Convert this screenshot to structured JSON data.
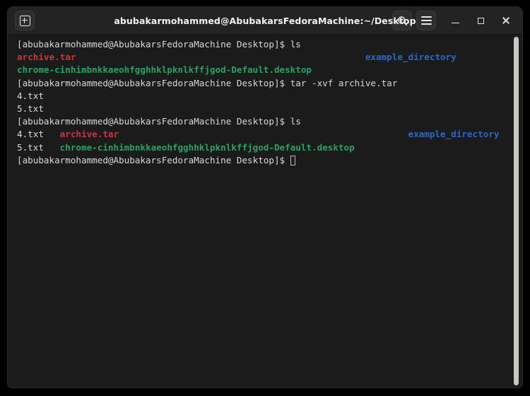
{
  "window": {
    "title": "abubakarmohammed@AbubakarsFedoraMachine:~/Desktop",
    "new_tab_label": "+",
    "icons": {
      "new_tab": "new-tab-icon",
      "search": "search-icon",
      "menu": "hamburger-menu-icon",
      "minimize": "minimize-icon",
      "maximize": "maximize-icon",
      "close": "close-icon"
    }
  },
  "colors": {
    "background": "#1b1b1b",
    "titlebar": "#232323",
    "foreground": "#d8d8d8",
    "red": "#c9353f",
    "green": "#26a269",
    "blue": "#2a67c8",
    "scrollbar": "#c9c7c2"
  },
  "terminal": {
    "prompt": "[abubakarmohammed@AbubakarsFedoraMachine Desktop]$ ",
    "lines": [
      {
        "type": "prompt",
        "command": "ls"
      },
      {
        "type": "output",
        "cells": [
          {
            "text": "archive.tar",
            "color": "red",
            "pad_to": 65
          },
          {
            "text": "example_directory",
            "color": "blue"
          }
        ]
      },
      {
        "type": "output",
        "cells": [
          {
            "text": "chrome-cinhimbnkkaeohfgghhklpknlkffjgod-Default.desktop",
            "color": "green"
          }
        ]
      },
      {
        "type": "prompt",
        "command": "tar -xvf archive.tar"
      },
      {
        "type": "output",
        "cells": [
          {
            "text": "4.txt",
            "color": "white"
          }
        ]
      },
      {
        "type": "output",
        "cells": [
          {
            "text": "5.txt",
            "color": "white"
          }
        ]
      },
      {
        "type": "prompt",
        "command": "ls"
      },
      {
        "type": "output",
        "cells": [
          {
            "text": "4.txt",
            "color": "white",
            "pad_to": 8
          },
          {
            "text": "archive.tar",
            "color": "red",
            "pad_to": 73
          },
          {
            "text": "example_directory",
            "color": "blue"
          }
        ]
      },
      {
        "type": "output",
        "cells": [
          {
            "text": "5.txt",
            "color": "white",
            "pad_to": 8
          },
          {
            "text": "chrome-cinhimbnkkaeohfgghhklpknlkffjgod-Default.desktop",
            "color": "green"
          }
        ]
      },
      {
        "type": "prompt",
        "command": "",
        "cursor": true
      }
    ]
  }
}
